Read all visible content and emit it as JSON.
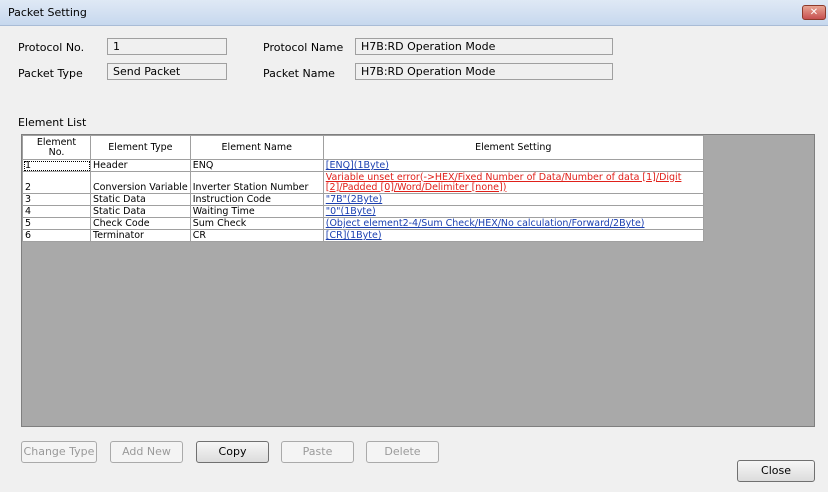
{
  "window": {
    "title": "Packet Setting",
    "close_glyph": "✕"
  },
  "form": {
    "protocol_no_label": "Protocol No.",
    "protocol_no_value": "1",
    "packet_type_label": "Packet Type",
    "packet_type_value": "Send Packet",
    "protocol_name_label": "Protocol Name",
    "protocol_name_value": "H7B:RD Operation Mode",
    "packet_name_label": "Packet Name",
    "packet_name_value": "H7B:RD Operation Mode"
  },
  "element_list": {
    "label": "Element List",
    "headers": {
      "no_line1": "Element",
      "no_line2": "No.",
      "type": "Element Type",
      "name": "Element Name",
      "setting": "Element Setting"
    },
    "rows": [
      {
        "no": "1",
        "type": "Header",
        "name": "ENQ",
        "setting": "[ENQ](1Byte)"
      },
      {
        "no": "2",
        "type": "Conversion Variable",
        "name": "Inverter Station Number",
        "setting": "Variable unset error(->HEX/Fixed Number of Data/Number of data [1]/Digit [2]/Padded [0]/Word/Delimiter [none])"
      },
      {
        "no": "3",
        "type": "Static Data",
        "name": "Instruction Code",
        "setting": "\"7B\"(2Byte)"
      },
      {
        "no": "4",
        "type": "Static Data",
        "name": "Waiting Time",
        "setting": "\"0\"(1Byte)"
      },
      {
        "no": "5",
        "type": "Check Code",
        "name": "Sum Check",
        "setting": "(Object element2-4/Sum Check/HEX/No calculation/Forward/2Byte)"
      },
      {
        "no": "6",
        "type": "Terminator",
        "name": "CR",
        "setting": "[CR](1Byte)"
      }
    ]
  },
  "buttons": {
    "change_type": "Change Type",
    "add_new": "Add New",
    "copy": "Copy",
    "paste": "Paste",
    "delete": "Delete",
    "close": "Close"
  },
  "colors": {
    "link": "#1a3fb0",
    "error": "#e0201a",
    "grid_background": "#a9a9a9"
  }
}
